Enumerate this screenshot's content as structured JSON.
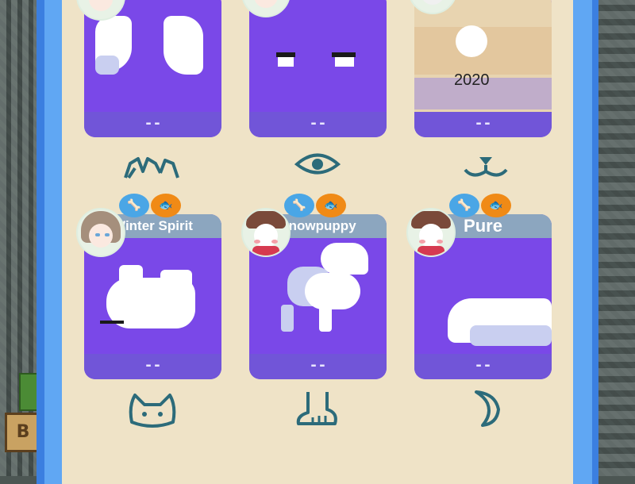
{
  "cards": [
    {
      "id": "card-1",
      "name": "",
      "footer": "--",
      "trait_icon": "ears-icon",
      "has_avatar": true,
      "has_badges": false
    },
    {
      "id": "card-2",
      "name": "",
      "footer": "--",
      "trait_icon": "eye-icon",
      "has_avatar": true,
      "has_badges": false
    },
    {
      "id": "card-3",
      "name": "",
      "footer": "--",
      "overlay_text": "2020",
      "trait_icon": "mouth-icon",
      "has_avatar": true,
      "has_badges": false
    },
    {
      "id": "card-4",
      "name": "Winter Spirit",
      "footer": "--",
      "trait_icon": "cat-head-icon",
      "has_avatar": true,
      "has_badges": true
    },
    {
      "id": "card-5",
      "name": "Snowpuppy",
      "footer": "--",
      "trait_icon": "foot-icon",
      "has_avatar": true,
      "has_badges": true
    },
    {
      "id": "card-6",
      "name": "Pure",
      "footer": "--",
      "trait_icon": "tail-icon",
      "has_avatar": true,
      "has_badges": true
    }
  ],
  "badges": {
    "bone": "bone-icon",
    "fish": "fish-icon"
  },
  "background_sign_text": "B",
  "colors": {
    "card_purple": "#7b4fea",
    "footer_purple": "#7155d8",
    "panel": "#efe3c7",
    "frame_blue": "#3b7fe0",
    "name_tag": "#8ca6bf",
    "icon_teal": "#2c6b7a"
  }
}
